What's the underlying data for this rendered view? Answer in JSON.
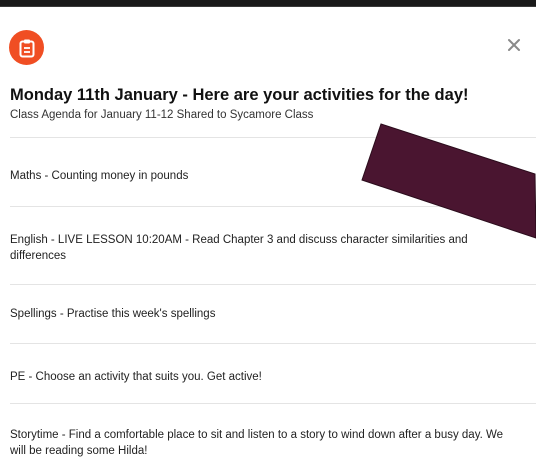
{
  "header": {
    "icon": "clipboard-icon",
    "close_icon": "close-icon",
    "close_glyph": "✕",
    "accent_color": "#f04e23"
  },
  "post": {
    "title": "Monday 11th January - Here are your activities for the day!",
    "subtitle": "Class Agenda for January 11-12 Shared to Sycamore Class"
  },
  "activities": [
    "Maths - Counting money in pounds",
    "English - LIVE LESSON 10:20AM - Read Chapter 3 and discuss character similarities and differences",
    "Spellings - Practise this week's spellings",
    "PE - Choose an activity that suits you. Get active!",
    "Storytime - Find a comfortable place to sit and listen to a story to wind down after a busy day. We will be reading some Hilda!"
  ],
  "annotation": {
    "shape": "arrow",
    "color": "#4a1530"
  }
}
